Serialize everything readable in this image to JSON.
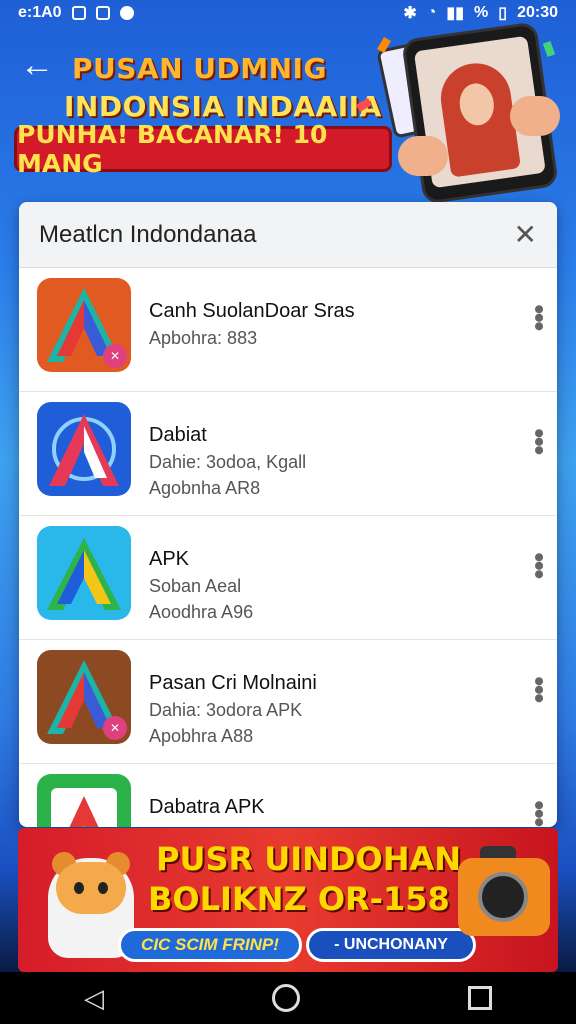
{
  "status_bar": {
    "left_text": "e:1A0",
    "time": "20:30",
    "battery": "%"
  },
  "hero": {
    "line1": "PUSAN UDMNIG",
    "line2": "INDONSIA INDAAIIA",
    "banner": "PUNHA! BACANAR! 10 MANG"
  },
  "dialog": {
    "title": "Meatlcn Indondanaa",
    "close_icon": "close-icon",
    "apps": [
      {
        "name": "Canh SuolanDoar Sras",
        "line1": "Apbohra: 883",
        "line2": "",
        "icon_bg": "#e05a22",
        "badge": "✕"
      },
      {
        "name": "Dabiat",
        "line1": "Dahie: 3odoa, Kgall",
        "line2": "Agobnha AR8",
        "icon_bg": "#1f5ed8",
        "badge": ""
      },
      {
        "name": "APK",
        "line1": "Soban Aeal",
        "line2": "Aoodhra A96",
        "icon_bg": "#2ab7ea",
        "badge": ""
      },
      {
        "name": "Pasan Cri Molnaini",
        "line1": "Dahia: 3odora APK",
        "line2": "Apobhra A88",
        "icon_bg": "#8b4a22",
        "badge": "✕"
      },
      {
        "name": "Dabatra APK",
        "line1": "",
        "line2": "",
        "icon_bg": "#2bb34a",
        "badge": ""
      }
    ]
  },
  "promo": {
    "line1": "PUSR UINDOHAN",
    "line2": "BOLIKNZ OR-158",
    "pill_left": "CIC SCIM FRINP!",
    "pill_right": "- UNCHONANY"
  }
}
